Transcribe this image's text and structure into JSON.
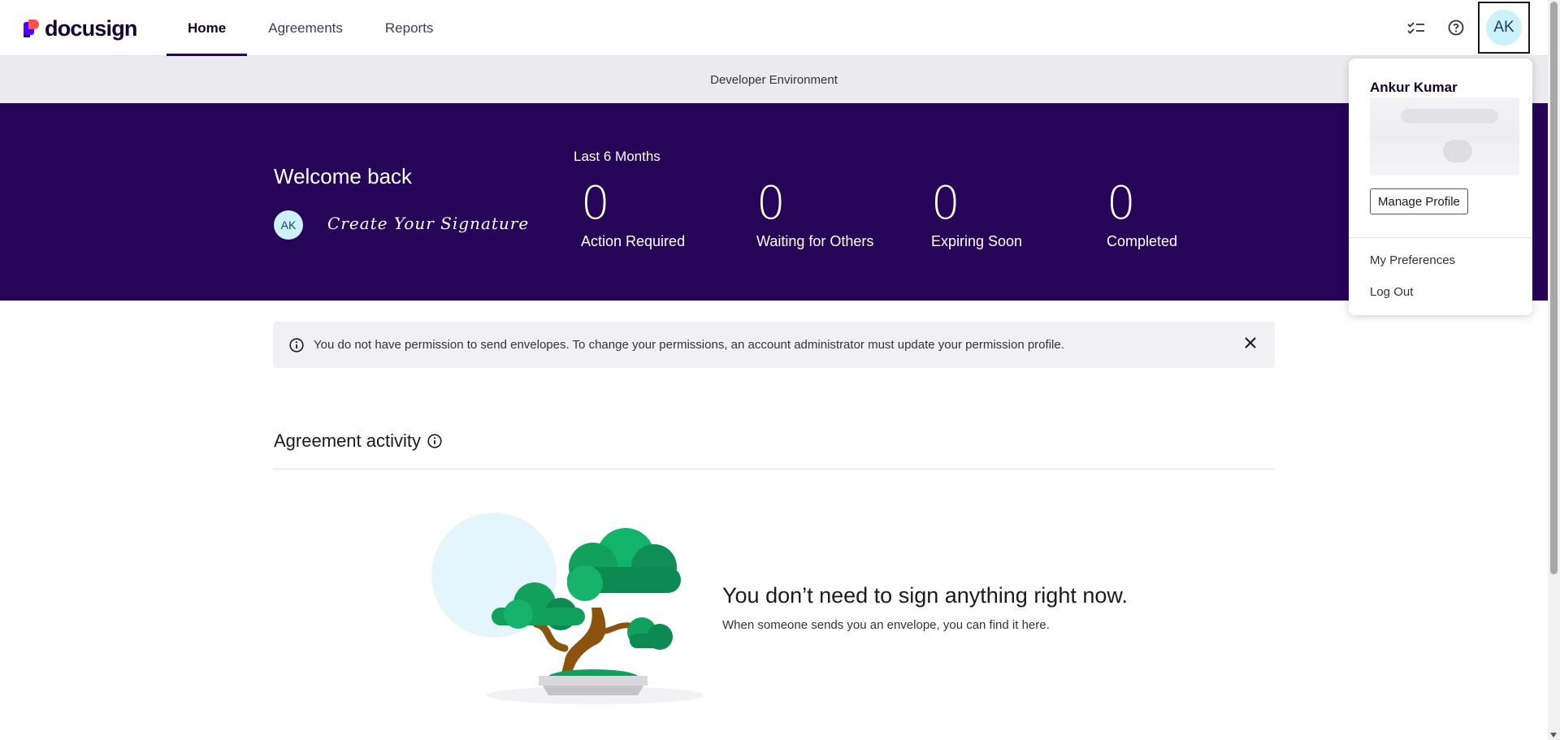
{
  "header": {
    "logo_text": "docusign",
    "nav": [
      {
        "label": "Home",
        "active": true
      },
      {
        "label": "Agreements",
        "active": false
      },
      {
        "label": "Reports",
        "active": false
      }
    ],
    "icons": [
      "checklist-icon",
      "help-icon"
    ],
    "avatar_initials": "AK"
  },
  "environment_banner": "Developer Environment",
  "hero": {
    "welcome": "Welcome back",
    "avatar_initials": "AK",
    "signature_prompt": "Create Your Signature",
    "period_label": "Last 6 Months",
    "stats": [
      {
        "value": "0",
        "label": "Action Required"
      },
      {
        "value": "0",
        "label": "Waiting for Others"
      },
      {
        "value": "0",
        "label": "Expiring Soon"
      },
      {
        "value": "0",
        "label": "Completed"
      }
    ]
  },
  "alert": {
    "message": "You do not have permission to send envelopes. To change your permissions, an account administrator must update your permission profile."
  },
  "activity": {
    "title": "Agreement activity",
    "empty_heading": "You don’t need to sign anything right now.",
    "empty_subtext": "When someone sends you an envelope, you can find it here."
  },
  "profile_menu": {
    "name": "Ankur Kumar",
    "manage_profile": "Manage Profile",
    "links": [
      "My Preferences",
      "Log Out"
    ]
  },
  "colors": {
    "brand_purple": "#260559",
    "accent_cyan": "#cbf2fa",
    "tree_green": "#12a15d"
  }
}
